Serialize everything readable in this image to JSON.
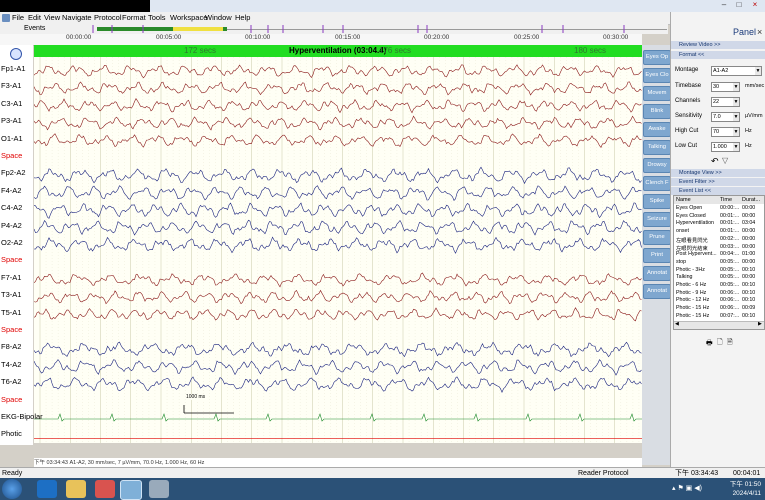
{
  "window": {
    "min_label": "–",
    "max_label": "□",
    "close_label": "×",
    "panel_title": "Panel",
    "panel_close_label": "×"
  },
  "menu": {
    "items": [
      "File",
      "Edit",
      "View",
      "Navigate",
      "Protocol",
      "Format",
      "Tools",
      "Workspace",
      "Window",
      "Help"
    ]
  },
  "events_bar": {
    "label": "Events"
  },
  "time_axis": {
    "ticks": [
      "00:00:00",
      "00:05:00",
      "00:10:00",
      "00:15:00",
      "00:20:00",
      "00:25:00",
      "00:30:00"
    ]
  },
  "banner": {
    "title": "Hyperventilation (03:04.4)",
    "left_secs": "172 secs",
    "mid_secs": "176 secs",
    "right_secs": "180 secs"
  },
  "channels": [
    {
      "label": "Fp1-A1",
      "color": "#8b1a1a"
    },
    {
      "label": "F3-A1",
      "color": "#8b1a1a"
    },
    {
      "label": "C3-A1",
      "color": "#8b1a1a"
    },
    {
      "label": "P3-A1",
      "color": "#8b1a1a"
    },
    {
      "label": "O1-A1",
      "color": "#8b1a1a"
    },
    {
      "label": "Space",
      "color": "#e00000"
    },
    {
      "label": "Fp2-A2",
      "color": "#1a237e"
    },
    {
      "label": "F4-A2",
      "color": "#1a237e"
    },
    {
      "label": "C4-A2",
      "color": "#1a237e"
    },
    {
      "label": "P4-A2",
      "color": "#1a237e"
    },
    {
      "label": "O2-A2",
      "color": "#1a237e"
    },
    {
      "label": "Space",
      "color": "#e00000"
    },
    {
      "label": "F7-A1",
      "color": "#8b1a1a"
    },
    {
      "label": "T3-A1",
      "color": "#8b1a1a"
    },
    {
      "label": "T5-A1",
      "color": "#8b1a1a"
    },
    {
      "label": "Space",
      "color": "#e00000"
    },
    {
      "label": "F8-A2",
      "color": "#1a237e"
    },
    {
      "label": "T4-A2",
      "color": "#1a237e"
    },
    {
      "label": "T6-A2",
      "color": "#1a237e"
    },
    {
      "label": "Space",
      "color": "#e00000"
    },
    {
      "label": "EKG-Bipolar",
      "color": "#1b8a2a"
    },
    {
      "label": "Photic",
      "color": "#e00000"
    }
  ],
  "scale_bar": {
    "label": "1000 ms"
  },
  "eeg_status": "下午 03:34:43 A1-A2, 30 mm/sec, 7 µV/mm, 70.0 Hz, 1.000 Hz, 60 Hz",
  "side_buttons": [
    "Eyes Op",
    "Eyes Clo",
    "Movem",
    "Blink",
    "Awake",
    "Talking",
    "Drowsy",
    "Clench F",
    "Spike",
    "Seizure",
    "Prune",
    "Print",
    "Annotat",
    "Annotat"
  ],
  "panel": {
    "review_video": "Review Video >>",
    "format": "Format <<",
    "montage_label": "Montage",
    "montage_value": "A1-A2",
    "timebase_label": "Timebase",
    "timebase_value": "30",
    "timebase_unit": "mm/sec",
    "channels_label": "Channels",
    "channels_value": "22",
    "sensitivity_label": "Sensitivity",
    "sensitivity_value": "7.0",
    "sensitivity_unit": "µV/mm",
    "highcut_label": "High Cut",
    "highcut_value": "70",
    "highcut_unit": "Hz",
    "lowcut_label": "Low Cut",
    "lowcut_value": "1.000",
    "lowcut_unit": "Hz",
    "montage_view": "Montage View >>",
    "event_filter": "Event Filter >>",
    "event_list": "Event List <<",
    "col_name": "Name",
    "col_time": "Time",
    "col_duration": "Durat..."
  },
  "events": [
    {
      "name": "Eyes Open",
      "time": "00:00:...",
      "dur": "00:00"
    },
    {
      "name": "Eyes Closed",
      "time": "00:01:...",
      "dur": "00:00"
    },
    {
      "name": "Hyperventilation",
      "time": "00:01:...",
      "dur": "03:04"
    },
    {
      "name": "onset",
      "time": "00:01:...",
      "dur": "00:00"
    },
    {
      "name": "左眼看見閃光",
      "time": "00:02:...",
      "dur": "00:00"
    },
    {
      "name": "左眼閃光結束",
      "time": "00:03:...",
      "dur": "00:00"
    },
    {
      "name": "Post Hypervent...",
      "time": "00:04:...",
      "dur": "01:00"
    },
    {
      "name": "stop",
      "time": "00:05:...",
      "dur": "00:00"
    },
    {
      "name": "Photic - 3Hz",
      "time": "00:05:...",
      "dur": "00:10"
    },
    {
      "name": "Talking",
      "time": "00:05:...",
      "dur": "00:00"
    },
    {
      "name": "Photic - 6 Hz",
      "time": "00:05:...",
      "dur": "00:10"
    },
    {
      "name": "Photic - 9 Hz",
      "time": "00:06:...",
      "dur": "00:10"
    },
    {
      "name": "Photic - 12 Hz",
      "time": "00:06:...",
      "dur": "00:10"
    },
    {
      "name": "Photic - 15 Hz",
      "time": "00:06:...",
      "dur": "00:09"
    },
    {
      "name": "Photic - 15 Hz",
      "time": "00:07:...",
      "dur": "00:10"
    }
  ],
  "statusbar": {
    "left": "Ready",
    "protocol": "Reader Protocol",
    "clock_time": "下午 03:34:43",
    "elapsed": "00:04:01"
  },
  "taskbar": {
    "time": "下午 01:50",
    "date": "2024/4/11"
  }
}
